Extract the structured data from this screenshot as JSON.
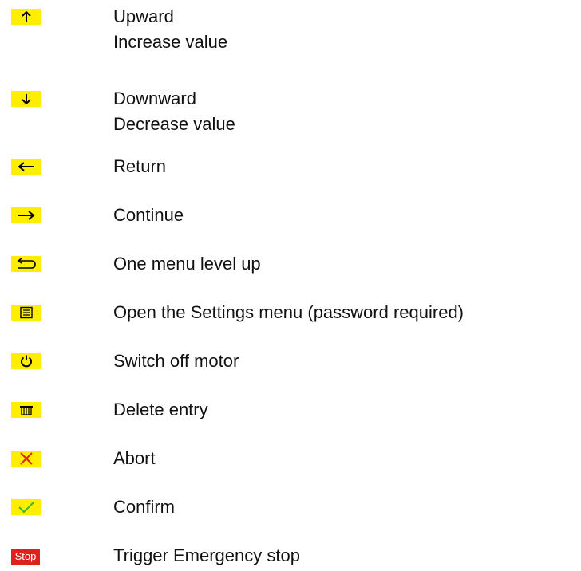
{
  "colors": {
    "key_background": "#ffee00",
    "abort_mark": "#e0211b",
    "confirm_mark": "#3db53a",
    "stop_background": "#e0211b"
  },
  "entries": [
    {
      "icon": "arrow-up-icon",
      "lines": [
        "Upward",
        "Increase value"
      ]
    },
    {
      "icon": "arrow-down-icon",
      "lines": [
        "Downward",
        "Decrease value"
      ]
    },
    {
      "icon": "arrow-left-icon",
      "lines": [
        "Return"
      ]
    },
    {
      "icon": "arrow-right-icon",
      "lines": [
        "Continue"
      ]
    },
    {
      "icon": "back-return-icon",
      "lines": [
        "One menu level up"
      ]
    },
    {
      "icon": "settings-menu-icon",
      "lines": [
        "Open the Settings menu (password required)"
      ]
    },
    {
      "icon": "power-icon",
      "lines": [
        "Switch off motor"
      ]
    },
    {
      "icon": "delete-trash-icon",
      "lines": [
        "Delete entry"
      ]
    },
    {
      "icon": "abort-x-icon",
      "lines": [
        "Abort"
      ]
    },
    {
      "icon": "confirm-check-icon",
      "lines": [
        "Confirm"
      ]
    },
    {
      "icon": "stop-icon",
      "icon_text": "Stop",
      "lines": [
        "Trigger Emergency stop"
      ]
    }
  ]
}
